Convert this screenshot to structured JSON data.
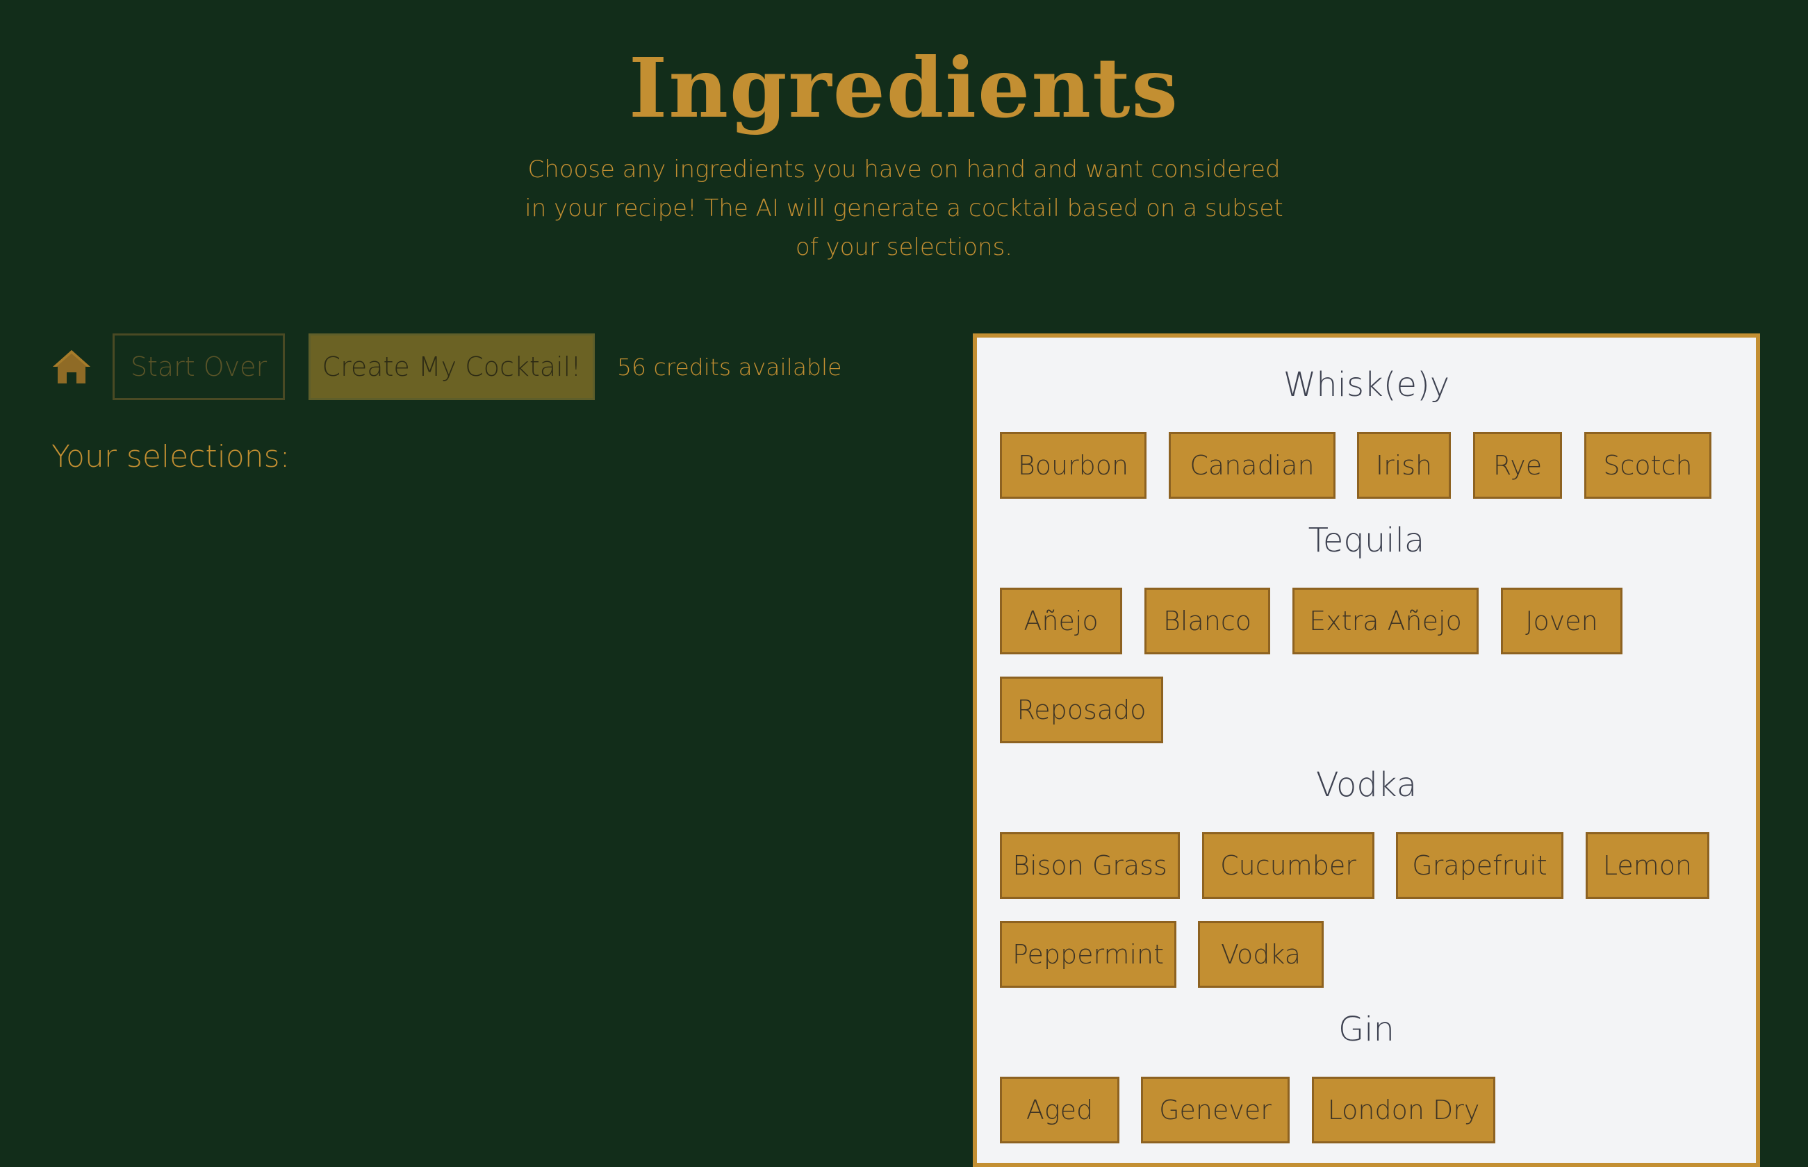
{
  "header": {
    "title": "Ingredients",
    "subtitle": "Choose any ingredients you have on hand and want considered in your recipe! The AI will generate a cocktail based on a subset of your selections."
  },
  "toolbar": {
    "home_icon": "home-icon",
    "start_over_label": "Start Over",
    "create_label": "Create My Cocktail!",
    "credits_text": "56 credits available"
  },
  "selections": {
    "label": "Your selections:"
  },
  "colors": {
    "background": "#122d1a",
    "accent": "#c38f32",
    "panel": "#f3f4f6",
    "heading_text": "#3d4150"
  },
  "categories": [
    {
      "name": "Whisk(e)y",
      "items": [
        "Bourbon",
        "Canadian",
        "Irish",
        "Rye",
        "Scotch"
      ]
    },
    {
      "name": "Tequila",
      "items": [
        "Añejo",
        "Blanco",
        "Extra Añejo",
        "Joven",
        "Reposado"
      ]
    },
    {
      "name": "Vodka",
      "items": [
        "Bison Grass",
        "Cucumber",
        "Grapefruit",
        "Lemon",
        "Peppermint",
        "Vodka"
      ]
    },
    {
      "name": "Gin",
      "items": [
        "Aged",
        "Genever",
        "London Dry"
      ]
    }
  ]
}
